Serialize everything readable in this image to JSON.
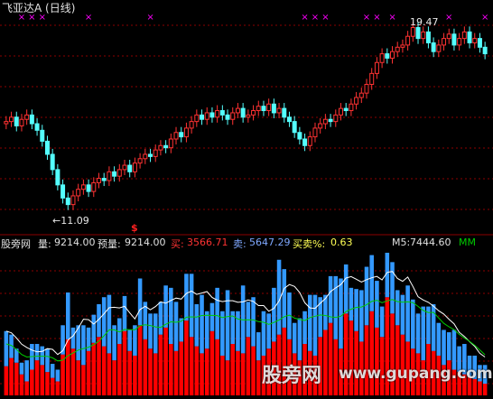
{
  "header": {
    "title": "飞亚达A (日线)"
  },
  "price_panel": {
    "low_label": "←11.09",
    "high_label": "19.47",
    "marker_symbol": "$",
    "x_marker_symbol": "×"
  },
  "volume_bar": {
    "source": "股旁网",
    "vol_label": "量:",
    "vol_value": "9214.00",
    "est_label": "预量:",
    "est_value": "9214.00",
    "buy_label": "买:",
    "buy_value": "3566.71",
    "sell_label": "卖:",
    "sell_value": "5647.29",
    "ratio_label": "买卖%:",
    "ratio_value": "0.63",
    "m5_label": "M5:",
    "m5_value": "7444.60",
    "mm_label": "MM"
  },
  "watermark": {
    "cn": "股旁网",
    "url": "www.gupang.com"
  },
  "colors": {
    "up": "#ff3232",
    "down": "#54ffff",
    "grid": "#8b0000",
    "buy": "#ff0000",
    "sell": "#3399ff",
    "m5": "#ffffff",
    "mm": "#00cc00",
    "marker": "#ff00ff"
  },
  "chart_data": {
    "type": "candlestick+volume",
    "price_ylim": [
      10.5,
      20.0
    ],
    "price_low": 11.09,
    "price_high": 19.47,
    "closes": [
      15.1,
      15.3,
      14.9,
      15.2,
      15.4,
      15.0,
      14.7,
      14.2,
      13.6,
      12.9,
      12.2,
      11.6,
      11.3,
      11.7,
      12.0,
      12.2,
      11.9,
      12.3,
      12.5,
      12.4,
      12.8,
      12.6,
      12.9,
      13.1,
      12.8,
      13.2,
      13.4,
      13.6,
      13.5,
      13.8,
      14.0,
      13.9,
      14.3,
      14.6,
      14.4,
      14.8,
      15.1,
      15.4,
      15.2,
      15.5,
      15.3,
      15.6,
      15.4,
      15.2,
      15.5,
      15.7,
      15.3,
      15.4,
      15.6,
      15.8,
      15.6,
      15.9,
      15.5,
      15.7,
      15.3,
      15.1,
      14.6,
      14.3,
      14.0,
      14.4,
      14.8,
      15.0,
      15.2,
      15.1,
      15.4,
      15.7,
      15.6,
      15.9,
      16.2,
      16.4,
      16.8,
      17.3,
      17.8,
      18.2,
      18.0,
      18.3,
      18.5,
      18.6,
      19.0,
      19.4,
      18.9,
      19.2,
      18.7,
      18.3,
      18.6,
      18.9,
      19.1,
      18.6,
      18.9,
      19.2,
      18.7,
      18.9,
      18.5,
      18.2
    ],
    "buy_volume": [
      25,
      32,
      28,
      18,
      12,
      22,
      30,
      26,
      20,
      15,
      12,
      35,
      48,
      40,
      30,
      26,
      38,
      45,
      50,
      42,
      36,
      30,
      44,
      55,
      38,
      34,
      60,
      48,
      40,
      36,
      52,
      58,
      44,
      38,
      46,
      64,
      50,
      42,
      36,
      40,
      55,
      48,
      34,
      30,
      44,
      38,
      36,
      50,
      42,
      30,
      34,
      40,
      46,
      52,
      58,
      48,
      36,
      30,
      44,
      38,
      34,
      50,
      56,
      62,
      48,
      40,
      70,
      64,
      55,
      46,
      60,
      72,
      58,
      50,
      84,
      70,
      60,
      52,
      46,
      40,
      36,
      30,
      44,
      38,
      34,
      26,
      30,
      22,
      20,
      18,
      16,
      14,
      12,
      10
    ],
    "sell_volume": [
      30,
      20,
      12,
      10,
      18,
      22,
      14,
      16,
      20,
      12,
      10,
      25,
      40,
      18,
      30,
      34,
      20,
      24,
      28,
      42,
      50,
      30,
      22,
      30,
      18,
      26,
      40,
      32,
      30,
      34,
      28,
      36,
      48,
      42,
      20,
      40,
      54,
      36,
      50,
      32,
      24,
      44,
      38,
      60,
      28,
      34,
      58,
      30,
      42,
      24,
      38,
      30,
      46,
      64,
      50,
      40,
      26,
      36,
      28,
      48,
      52,
      34,
      30,
      40,
      54,
      60,
      42,
      28,
      36,
      44,
      50,
      48,
      40,
      26,
      38,
      44,
      30,
      34,
      48,
      42,
      34,
      46,
      32,
      40,
      28,
      30,
      24,
      34,
      22,
      26,
      18,
      20,
      14,
      16
    ]
  }
}
